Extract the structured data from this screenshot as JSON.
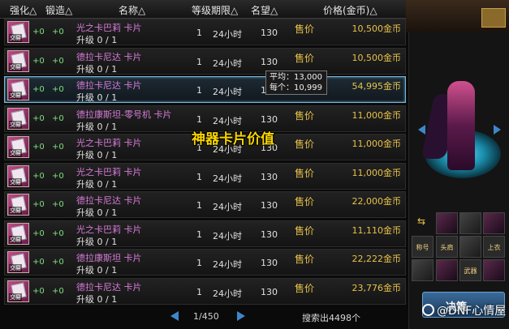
{
  "header": {
    "enhance": "强化△",
    "forge": "锻造△",
    "name": "名称△",
    "level": "等级",
    "period": "期限△",
    "fame": "名望△",
    "price": "价格(金币)△"
  },
  "rows": [
    {
      "plus1": "+0",
      "plus2": "+0",
      "name": "光之卡巴莉  卡片",
      "upgrade": "升级 0 / 1",
      "level": "1",
      "period": "24小时",
      "fame": "130",
      "sale": "售价",
      "price": "10,500金币",
      "tag": "交易"
    },
    {
      "plus1": "+0",
      "plus2": "+0",
      "name": "德拉卡尼达  卡片",
      "upgrade": "升级 0 / 1",
      "level": "1",
      "period": "24小时",
      "fame": "130",
      "sale": "售价",
      "price": "10,500金币",
      "tag": "交易"
    },
    {
      "plus1": "+0",
      "plus2": "+0",
      "name": "德拉卡尼达  卡片",
      "upgrade": "升级 0 / 1",
      "level": "1",
      "period": "24小时",
      "fame": "13",
      "sale": "售价",
      "price": "54,995金币",
      "tag": "交易"
    },
    {
      "plus1": "+0",
      "plus2": "+0",
      "name": "德拉康斯坦-零号机  卡片",
      "upgrade": "升级 0 / 1",
      "level": "1",
      "period": "24小时",
      "fame": "130",
      "sale": "售价",
      "price": "11,000金币",
      "tag": "交易"
    },
    {
      "plus1": "+0",
      "plus2": "+0",
      "name": "光之卡巴莉  卡片",
      "upgrade": "升级 0 / 1",
      "level": "1",
      "period": "24小时",
      "fame": "130",
      "sale": "售价",
      "price": "11,000金币",
      "tag": "交易"
    },
    {
      "plus1": "+0",
      "plus2": "+0",
      "name": "光之卡巴莉  卡片",
      "upgrade": "升级 0 / 1",
      "level": "1",
      "period": "24小时",
      "fame": "130",
      "sale": "售价",
      "price": "11,000金币",
      "tag": "交易"
    },
    {
      "plus1": "+0",
      "plus2": "+0",
      "name": "德拉卡尼达  卡片",
      "upgrade": "升级 0 / 1",
      "level": "1",
      "period": "24小时",
      "fame": "130",
      "sale": "售价",
      "price": "22,000金币",
      "tag": "交易"
    },
    {
      "plus1": "+0",
      "plus2": "+0",
      "name": "光之卡巴莉  卡片",
      "upgrade": "升级 0 / 1",
      "level": "1",
      "period": "24小时",
      "fame": "130",
      "sale": "售价",
      "price": "11,110金币",
      "tag": "交易"
    },
    {
      "plus1": "+0",
      "plus2": "+0",
      "name": "德拉康斯坦  卡片",
      "upgrade": "升级 0 / 1",
      "level": "1",
      "period": "24小时",
      "fame": "130",
      "sale": "售价",
      "price": "22,222金币",
      "tag": "交易"
    },
    {
      "plus1": "+0",
      "plus2": "+0",
      "name": "德拉卡尼达  卡片",
      "upgrade": "升级 0 / 1",
      "level": "1",
      "period": "24小时",
      "fame": "130",
      "sale": "售价",
      "price": "23,776金币",
      "tag": "交易"
    }
  ],
  "tooltip": {
    "avg": "平均：13,000",
    "each": "每个：10,999"
  },
  "overlay_text": "神器卡片价值",
  "pager": {
    "text": "1/450"
  },
  "search_result": "搜索出4498个",
  "right_panel": {
    "swap_glyph": "⇆",
    "slot_labels": [
      "称号",
      "头肩",
      "上衣",
      "武器"
    ],
    "button_label": "决策"
  },
  "watermark": "@DNF心情屋"
}
